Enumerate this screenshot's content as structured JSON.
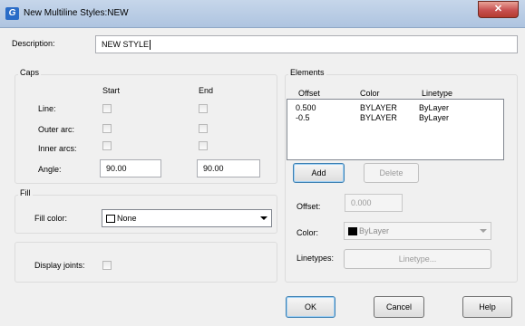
{
  "window": {
    "title": "New Multiline Styles:NEW",
    "close_glyph": "✕"
  },
  "description": {
    "label": "Description:",
    "value": "NEW STYLE"
  },
  "caps": {
    "title": "Caps",
    "col_start": "Start",
    "col_end": "End",
    "rows": [
      {
        "label": "Line:",
        "start_checked": false,
        "end_checked": false
      },
      {
        "label": "Outer arc:",
        "start_checked": false,
        "end_checked": false
      },
      {
        "label": "Inner arcs:",
        "start_checked": false,
        "end_checked": false
      }
    ],
    "angle_label": "Angle:",
    "angle_start": "90.00",
    "angle_end": "90.00"
  },
  "fill": {
    "title": "Fill",
    "color_label": "Fill color:",
    "color_value": "None"
  },
  "display_joints": {
    "label": "Display joints:",
    "checked": false
  },
  "elements": {
    "title": "Elements",
    "headers": {
      "offset": "Offset",
      "color": "Color",
      "linetype": "Linetype"
    },
    "rows": [
      {
        "offset": "0.500",
        "color": "BYLAYER",
        "linetype": "ByLayer"
      },
      {
        "offset": "-0.5",
        "color": "BYLAYER",
        "linetype": "ByLayer"
      }
    ],
    "add_label": "Add",
    "delete_label": "Delete",
    "offset_label": "Offset:",
    "offset_value": "0.000",
    "color_label": "Color:",
    "color_value": "ByLayer",
    "linetypes_label": "Linetypes:",
    "linetype_button": "Linetype..."
  },
  "footer": {
    "ok": "OK",
    "cancel": "Cancel",
    "help": "Help"
  },
  "colors": {
    "titlebar": "#b9cde6",
    "close": "#c75050",
    "swatch_bylayer": "#000000"
  }
}
